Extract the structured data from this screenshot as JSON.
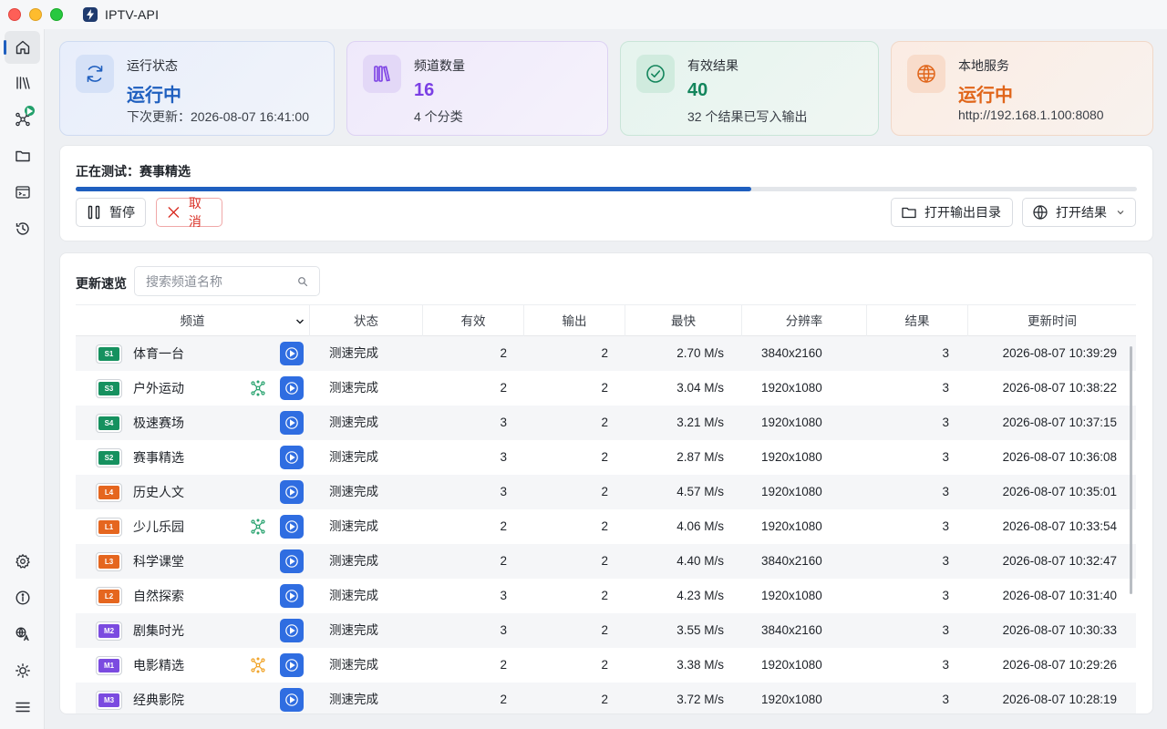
{
  "app": {
    "title": "IPTV-API"
  },
  "stats": [
    {
      "label": "运行状态",
      "value": "运行中",
      "sub": "下次更新：2026-08-07 16:41:00",
      "icon": "refresh-icon",
      "color": "#1f5fbf"
    },
    {
      "label": "频道数量",
      "value": "16",
      "sub": "4 个分类",
      "icon": "library-icon",
      "color": "#7b3fe4"
    },
    {
      "label": "有效结果",
      "value": "40",
      "sub": "32 个结果已写入输出",
      "icon": "check-circle-icon",
      "color": "#13855c"
    },
    {
      "label": "本地服务",
      "value": "运行中",
      "sub": "http://192.168.1.100:8080",
      "icon": "globe-icon",
      "color": "#e0651a"
    }
  ],
  "progress": {
    "label_prefix": "正在测试：",
    "current": "赛事精选",
    "fraction": 0.637,
    "pause_label": "暂停",
    "cancel_label": "取消",
    "open_output_label": "打开输出目录",
    "open_result_label": "打开结果"
  },
  "table": {
    "title": "更新速览",
    "search_placeholder": "搜索频道名称",
    "columns": [
      "频道",
      "状态",
      "有效",
      "输出",
      "最快",
      "分辨率",
      "结果",
      "更新时间"
    ],
    "rows": [
      {
        "code": "S1",
        "group_color": "#16915f",
        "name": "体育一台",
        "net": "",
        "status": "测速完成",
        "valid": "2",
        "output": "2",
        "fastest": "2.70 M/s",
        "resolution": "3840x2160",
        "result": "3",
        "time": "2026-08-07 10:39:29"
      },
      {
        "code": "S3",
        "group_color": "#16915f",
        "name": "户外运动",
        "net": "#22a06b",
        "status": "测速完成",
        "valid": "2",
        "output": "2",
        "fastest": "3.04 M/s",
        "resolution": "1920x1080",
        "result": "3",
        "time": "2026-08-07 10:38:22"
      },
      {
        "code": "S4",
        "group_color": "#16915f",
        "name": "极速赛场",
        "net": "",
        "status": "测速完成",
        "valid": "3",
        "output": "2",
        "fastest": "3.21 M/s",
        "resolution": "1920x1080",
        "result": "3",
        "time": "2026-08-07 10:37:15"
      },
      {
        "code": "S2",
        "group_color": "#16915f",
        "name": "赛事精选",
        "net": "",
        "status": "测速完成",
        "valid": "3",
        "output": "2",
        "fastest": "2.87 M/s",
        "resolution": "1920x1080",
        "result": "3",
        "time": "2026-08-07 10:36:08"
      },
      {
        "code": "L4",
        "group_color": "#e5661f",
        "name": "历史人文",
        "net": "",
        "status": "测速完成",
        "valid": "3",
        "output": "2",
        "fastest": "4.57 M/s",
        "resolution": "1920x1080",
        "result": "3",
        "time": "2026-08-07 10:35:01"
      },
      {
        "code": "L1",
        "group_color": "#e5661f",
        "name": "少儿乐园",
        "net": "#22a06b",
        "status": "测速完成",
        "valid": "2",
        "output": "2",
        "fastest": "4.06 M/s",
        "resolution": "1920x1080",
        "result": "3",
        "time": "2026-08-07 10:33:54"
      },
      {
        "code": "L3",
        "group_color": "#e5661f",
        "name": "科学课堂",
        "net": "",
        "status": "测速完成",
        "valid": "2",
        "output": "2",
        "fastest": "4.40 M/s",
        "resolution": "3840x2160",
        "result": "3",
        "time": "2026-08-07 10:32:47"
      },
      {
        "code": "L2",
        "group_color": "#e5661f",
        "name": "自然探索",
        "net": "",
        "status": "测速完成",
        "valid": "3",
        "output": "2",
        "fastest": "4.23 M/s",
        "resolution": "1920x1080",
        "result": "3",
        "time": "2026-08-07 10:31:40"
      },
      {
        "code": "M2",
        "group_color": "#7b4be0",
        "name": "剧集时光",
        "net": "",
        "status": "测速完成",
        "valid": "3",
        "output": "2",
        "fastest": "3.55 M/s",
        "resolution": "3840x2160",
        "result": "3",
        "time": "2026-08-07 10:30:33"
      },
      {
        "code": "M1",
        "group_color": "#7b4be0",
        "name": "电影精选",
        "net": "#f0a020",
        "status": "测速完成",
        "valid": "2",
        "output": "2",
        "fastest": "3.38 M/s",
        "resolution": "1920x1080",
        "result": "3",
        "time": "2026-08-07 10:29:26"
      },
      {
        "code": "M3",
        "group_color": "#7b4be0",
        "name": "经典影院",
        "net": "",
        "status": "测速完成",
        "valid": "2",
        "output": "2",
        "fastest": "3.72 M/s",
        "resolution": "1920x1080",
        "result": "3",
        "time": "2026-08-07 10:28:19"
      }
    ]
  }
}
